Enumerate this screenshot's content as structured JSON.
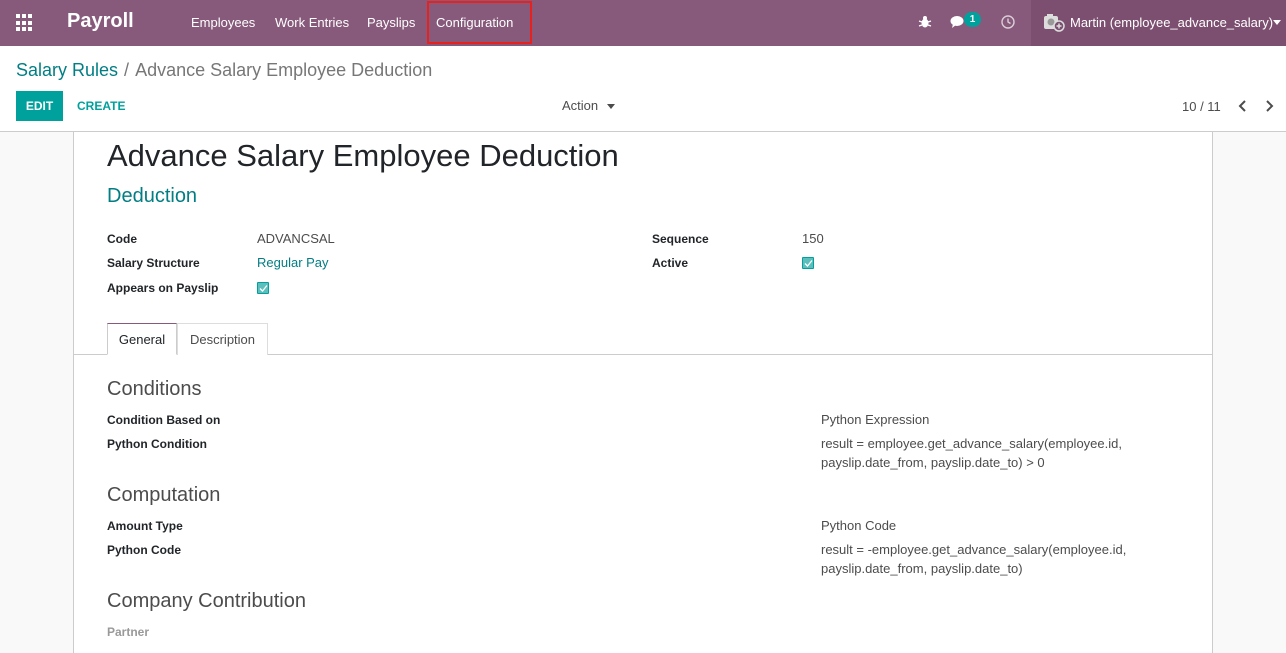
{
  "navbar": {
    "brand": "Payroll",
    "menu": [
      "Employees",
      "Work Entries",
      "Payslips",
      "Configuration"
    ],
    "chat_count": "1",
    "user": "Martin (employee_advance_salary)"
  },
  "breadcrumb": {
    "parent": "Salary Rules",
    "separator": "/",
    "current": "Advance Salary Employee Deduction"
  },
  "buttons": {
    "edit": "EDIT",
    "create": "CREATE",
    "action": "Action"
  },
  "pager": {
    "value": "10 / 11"
  },
  "record": {
    "title": "Advance Salary Employee Deduction",
    "category": "Deduction",
    "fields": {
      "code_label": "Code",
      "code_value": "ADVANCSAL",
      "structure_label": "Salary Structure",
      "structure_value": "Regular Pay",
      "appears_label": "Appears on Payslip",
      "appears_checked": true,
      "sequence_label": "Sequence",
      "sequence_value": "150",
      "active_label": "Active",
      "active_checked": true
    }
  },
  "tabs": [
    "General",
    "Description"
  ],
  "conditions": {
    "title": "Conditions",
    "based_on_label": "Condition Based on",
    "based_on_value": "Python Expression",
    "python_label": "Python Condition",
    "python_value": "result = employee.get_advance_salary(employee.id, payslip.date_from, payslip.date_to) > 0"
  },
  "computation": {
    "title": "Computation",
    "amount_type_label": "Amount Type",
    "amount_type_value": "Python Code",
    "code_label": "Python Code",
    "code_value": "result = -employee.get_advance_salary(employee.id, payslip.date_from, payslip.date_to)"
  },
  "contribution": {
    "title": "Company Contribution",
    "partner_label": "Partner"
  },
  "colors": {
    "navbar": "#875a7b",
    "accent": "#00a09d",
    "link": "#017e84",
    "highlight": "#e8201e"
  }
}
